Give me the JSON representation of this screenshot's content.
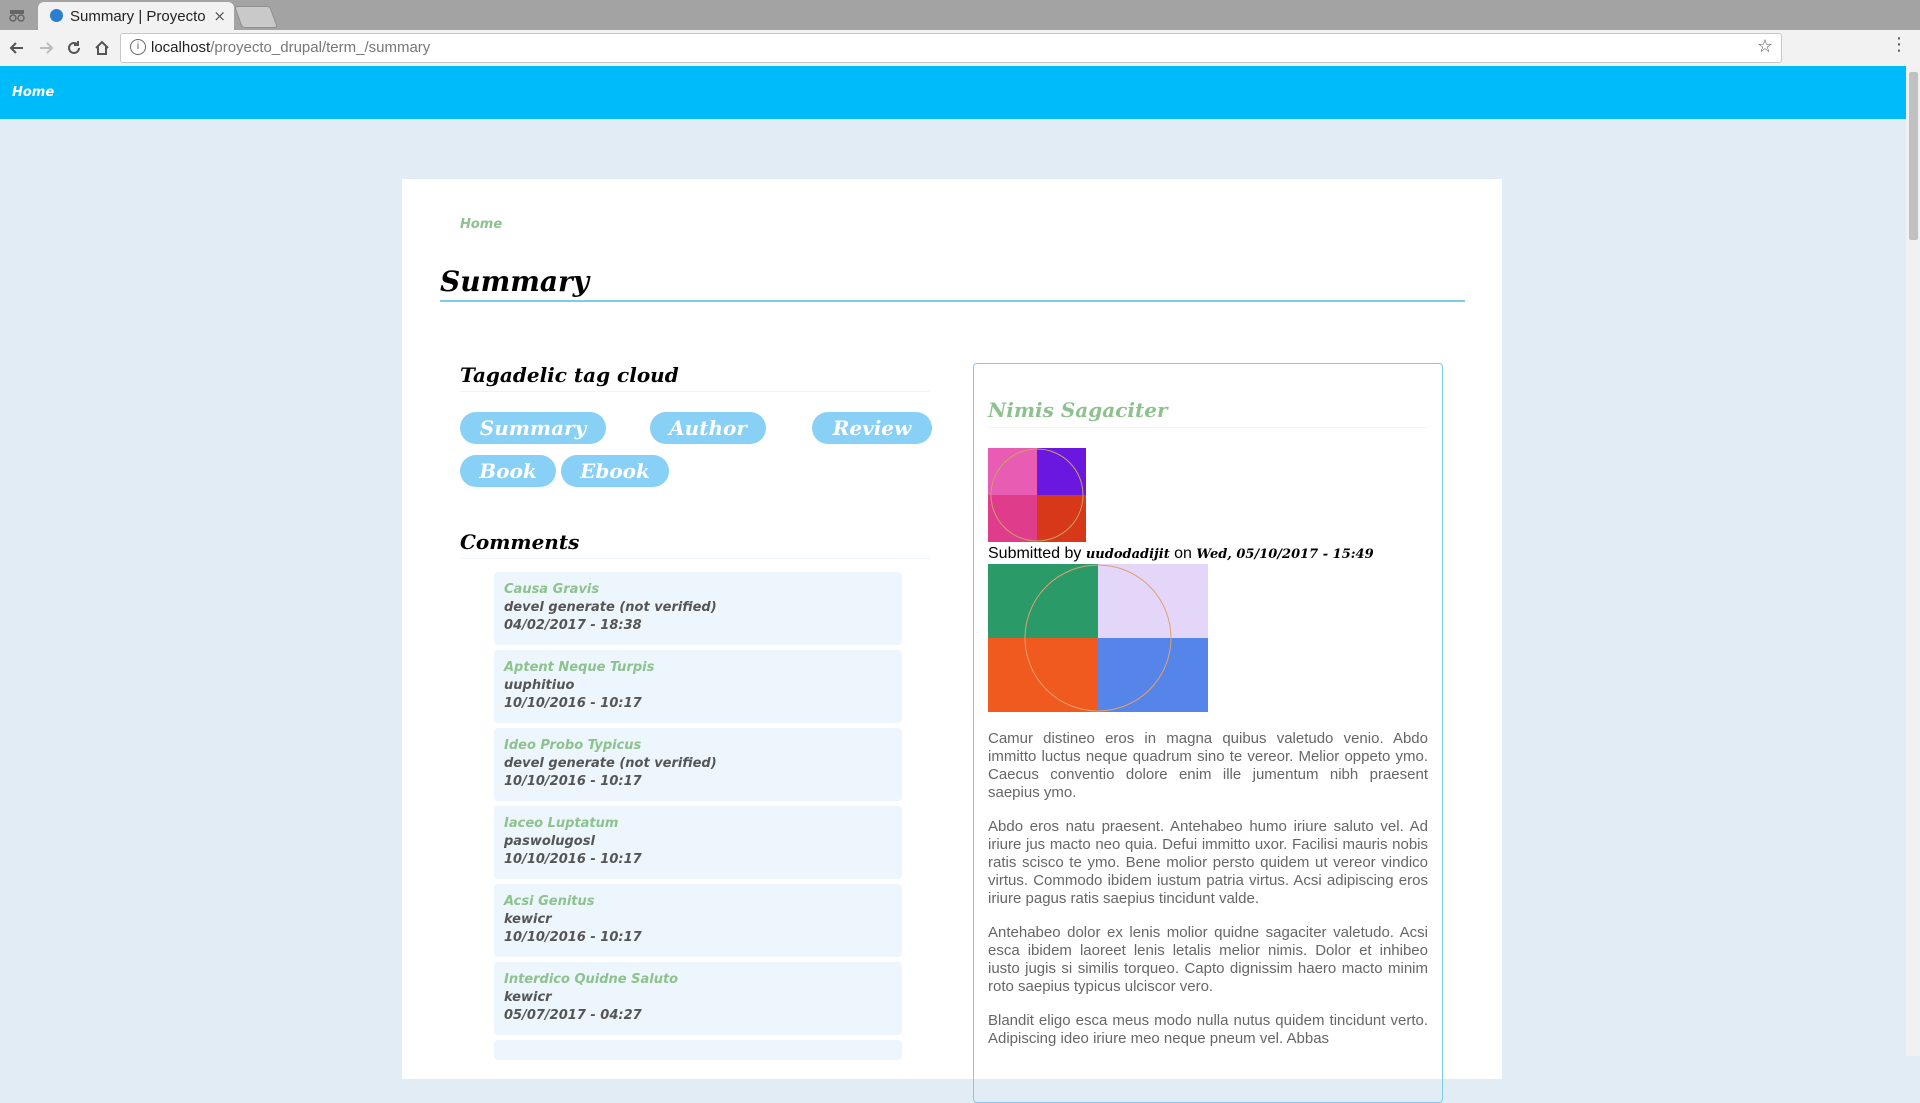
{
  "browser": {
    "tab_title": "Summary | Proyecto",
    "tab_close": "×",
    "url_host": "localhost",
    "url_path": "/proyecto_drupal/term_/summary",
    "info_glyph": "i"
  },
  "site": {
    "home_link": "Home"
  },
  "breadcrumb": "Home",
  "page_title": "Summary",
  "tag_cloud": {
    "title": "Tagadelic tag cloud",
    "tags": [
      "Summary",
      "Author",
      "Review",
      "Book",
      "Ebook"
    ]
  },
  "comments": {
    "title": "Comments",
    "items": [
      {
        "title": "Causa Gravis",
        "author": "devel generate (not verified)",
        "date": "04/02/2017 - 18:38"
      },
      {
        "title": "Aptent Neque Turpis",
        "author": "uuphitiuo",
        "date": "10/10/2016 - 10:17"
      },
      {
        "title": "Ideo Probo Typicus",
        "author": "devel generate (not verified)",
        "date": "10/10/2016 - 10:17"
      },
      {
        "title": "Iaceo Luptatum",
        "author": "paswolugosl",
        "date": "10/10/2016 - 10:17"
      },
      {
        "title": "Acsi Genitus",
        "author": "kewicr",
        "date": "10/10/2016 - 10:17"
      },
      {
        "title": "Interdico Quidne Saluto",
        "author": "kewicr",
        "date": "05/07/2017 - 04:27"
      }
    ]
  },
  "node": {
    "title": "Nimis Sagaciter",
    "submitted_by": "Submitted by",
    "author": "uudodadijit",
    "on": "on",
    "date": "Wed, 05/10/2017 - 15:49",
    "paragraphs": [
      "Camur distineo eros in magna quibus valetudo venio. Abdo immitto luctus neque quadrum sino te vereor. Melior oppeto ymo. Caecus conventio dolore enim ille jumentum nibh praesent saepius ymo.",
      "Abdo eros natu praesent. Antehabeo humo iriure saluto vel. Ad iriure jus macto neo quia. Defui immitto uxor. Facilisi mauris nobis ratis scisco te ymo. Bene molior persto quidem ut vereor vindico virtus. Commodo ibidem iustum patria virtus. Acsi adipiscing eros iriure pagus ratis saepius tincidunt valde.",
      "Antehabeo dolor ex lenis molior quidne sagaciter valetudo. Acsi esca ibidem laoreet lenis letalis melior nimis. Dolor et inhibeo iusto jugis si similis torqueo. Capto dignissim haero macto minim roto saepius typicus ulciscor vero.",
      "Blandit eligo esca meus modo nulla nutus quidem tincidunt verto. Adipiscing ideo iriure meo neque pneum vel. Abbas"
    ]
  },
  "colors": {
    "header_bg": "#00bbf9",
    "link_green": "#8dc28e",
    "tag_bg": "#88d0f6",
    "accent_rule": "#7ccbe8"
  }
}
